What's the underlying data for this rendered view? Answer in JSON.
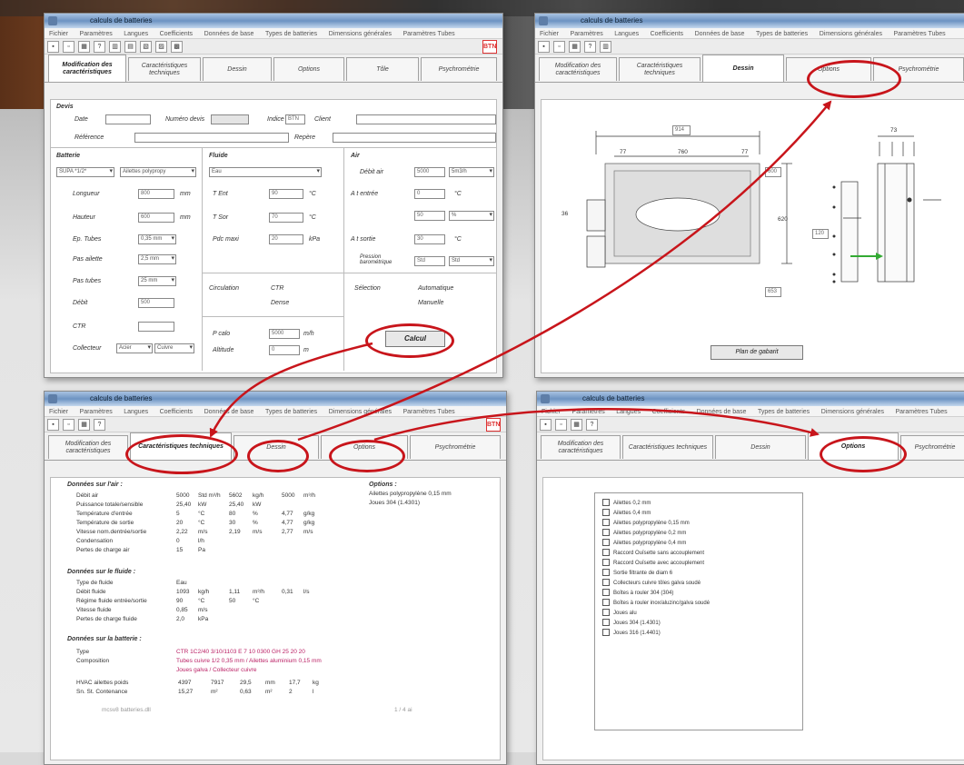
{
  "window_title": "calculs de batteries",
  "menu": [
    "Fichier",
    "Paramètres",
    "Langues",
    "Coefficients",
    "Données de base",
    "Types de batteries",
    "Dimensions générales",
    "Paramètres Tubes"
  ],
  "logo_text": "BTN",
  "tabs": [
    "Modification des caractéristiques",
    "Caractéristiques techniques",
    "Dessin",
    "Options",
    "Tôle",
    "Psychrométrie"
  ],
  "tab_names_window2": [
    "Modification des caractéristiques",
    "Caractéristiques techniques",
    "Dessin",
    "Options",
    "Psychrométrie"
  ],
  "form": {
    "devis_title": "Devis",
    "date_label": "Date",
    "numero_label": "Numéro devis",
    "indice_label": "Indice",
    "indice_value": "BTN",
    "client_label": "Client",
    "reference_label": "Référence",
    "repere_label": "Repère",
    "batterie_title": "Batterie",
    "batterie_type": "SUPA *1/2*",
    "batterie_material": "Ailettes polypropy",
    "longueur_label": "Longueur",
    "longueur_value": "800",
    "hauteur_label": "Hauteur",
    "hauteur_value": "600",
    "ecart_label": "Ep. Tubes",
    "ecart_value": "0,35 mm",
    "pas_label": "Pas ailette",
    "pas_value": "2,5 mm",
    "pas2_label": "Pas tubes",
    "pas2_value": "25 mm",
    "debit_label": "Débit",
    "debit_value": "500",
    "ctr_label": "CTR",
    "collecteur_label": "Collecteur",
    "collecteur_value": "Acier",
    "collecteur_value2": "Cuivre",
    "unit_mm": "mm",
    "fluide_title": "Fluide",
    "fluide_type": "Eau",
    "tent_label": "T Ent",
    "tent_value": "90",
    "tsor_label": "T Sor",
    "tsor_value": "70",
    "pression_label": "Pdc maxi",
    "pression_value": "20",
    "unit_deg": "°C",
    "unit_kpa": "kPa",
    "circulation_label": "Circulation",
    "circ_opt1": "CTR",
    "circ_opt2": "Dense",
    "pcalo_label": "P calo",
    "pcalo_value": "5000",
    "pcalo_unit": "m/h",
    "altitude_label": "Altitude",
    "altitude_value": "0",
    "altitude_unit": "m",
    "air_title": "Air",
    "air_debit_label": "Débit air",
    "air_debit_value": "5000",
    "air_debit_unit": "5m3/h",
    "air_tent_label": "A t entrée",
    "air_tent_value": "0",
    "air_hr_value": "50",
    "air_hr_unit": "%",
    "air_tsor_label": "A t sortie",
    "air_tsor_value": "30",
    "vitesse_label": "Pression barométrique",
    "vitesse_value": "Std",
    "vitesse_unit": "Std",
    "selection_label": "Sélection",
    "sel_opt1": "Automatique",
    "sel_opt2": "Manuelle",
    "calc_button": "Calcul"
  },
  "drawing": {
    "dim_total": "914",
    "dim_inner": "760",
    "dim_left": "77",
    "dim_right": "77",
    "dim_height": "600",
    "dim_h2": "620",
    "dim_bottom": "653",
    "dim_side": "120",
    "dim_side2": "36",
    "dim_right_top": "73",
    "button_label": "Plan de gabarit"
  },
  "results": {
    "section_air": "Données sur l'air :",
    "rows_air": [
      {
        "label": "Débit air",
        "v1": "5000",
        "u1": "Std m³/h",
        "v2": "5602",
        "u2": "kg/h",
        "v3": "5000",
        "u3": "m³/h"
      },
      {
        "label": "Puissance totale/sensible",
        "v1": "25,40",
        "u1": "kW",
        "v2": "25,40",
        "u2": "kW",
        "v3": "",
        "u3": ""
      },
      {
        "label": "Température d'entrée",
        "v1": "5",
        "u1": "°C",
        "v2": "80",
        "u2": "%",
        "v3": "4,77",
        "u3": "g/kg"
      },
      {
        "label": "Température de sortie",
        "v1": "20",
        "u1": "°C",
        "v2": "30",
        "u2": "%",
        "v3": "4,77",
        "u3": "g/kg"
      },
      {
        "label": "Vitesse nom.dentrée/sortie",
        "v1": "2,22",
        "u1": "m/s",
        "v2": "2,19",
        "u2": "m/s",
        "v3": "2,77",
        "u3": "m/s"
      },
      {
        "label": "Condensation",
        "v1": "0",
        "u1": "l/h",
        "v2": "",
        "u2": "",
        "v3": "",
        "u3": ""
      },
      {
        "label": "Pertes de charge air",
        "v1": "15",
        "u1": "Pa",
        "v2": "",
        "u2": "",
        "v3": "",
        "u3": ""
      }
    ],
    "section_fluid": "Données sur le fluide :",
    "rows_fluid": [
      {
        "label": "Type de fluide",
        "v1": "Eau",
        "u1": "",
        "v2": "",
        "u2": "",
        "v3": "",
        "u3": ""
      },
      {
        "label": "Débit fluide",
        "v1": "1093",
        "u1": "kg/h",
        "v2": "1,11",
        "u2": "m³/h",
        "v3": "0,31",
        "u3": "l/s"
      },
      {
        "label": "Régime fluide entrée/sortie",
        "v1": "90",
        "u1": "°C",
        "v2": "50",
        "u2": "°C",
        "v3": "",
        "u3": ""
      },
      {
        "label": "Vitesse fluide",
        "v1": "0,85",
        "u1": "m/s",
        "v2": "",
        "u2": "",
        "v3": "",
        "u3": ""
      },
      {
        "label": "Pertes de charge fluide",
        "v1": "2,0",
        "u1": "kPa",
        "v2": "",
        "u2": "",
        "v3": "",
        "u3": ""
      }
    ],
    "section_batt": "Données sur la batterie :",
    "type_label": "Type",
    "type_value": "CTR 1C2/40 3/10/1103 E 7 10 0300 GH 25 20 20",
    "compo_label": "Composition",
    "compo_value": "Tubes cuivre 1/2 0,35 mm / Ailettes aluminium 0,15 mm",
    "compo_value2": "Joues galva / Collecteur cuivre",
    "hvac_label": "HVAC ailettes poids",
    "hvac_v1": "4397",
    "hvac_v2": "7917",
    "hvac_v3": "29,5",
    "hvac_u3": "mm",
    "hvac_v4": "17,7",
    "hvac_u4": "kg",
    "surf_label": "Sn. St. Contenance",
    "surf_v1": "15,27",
    "surf_u1": "m²",
    "surf_v2": "0,63",
    "surf_u2": "m²",
    "surf_v3": "2",
    "surf_u3": "l",
    "footer_left": "mcsv8 batteries.dll",
    "footer_right": "1 / 4 ai",
    "options_title": "Options :",
    "options_line1": "Ailettes polypropylène 0,15 mm",
    "options_line2": "Joues 304 (1.4301)"
  },
  "options_list": [
    "Ailettes 0,2 mm",
    "Ailettes 0,4 mm",
    "Ailettes polypropylène 0,15 mm",
    "Ailettes polypropylène 0,2 mm",
    "Ailettes polypropylène 0,4 mm",
    "Raccord Ouïsette sans accouplement",
    "Raccord Ouïsette avec accouplement",
    "Sortie filtrante de diam 6",
    "Collecteurs cuivre tôles galva soudé",
    "Boîtes à rouler 304 (304)",
    "Boîtes à rouler inox/aluzinc/galva soudé",
    "Joues alu",
    "Joues 304 (1.4301)",
    "Joues 316 (1.4401)"
  ],
  "colors": {
    "accent_red": "#c8151b"
  }
}
